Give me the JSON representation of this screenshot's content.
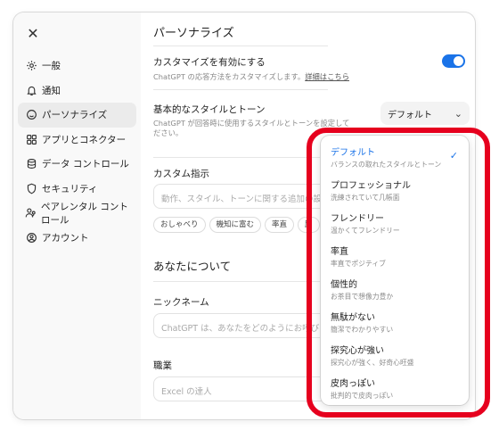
{
  "sidebar": {
    "close_label": "✕",
    "items": [
      {
        "label": "一般",
        "icon": "gear-icon"
      },
      {
        "label": "通知",
        "icon": "bell-icon"
      },
      {
        "label": "パーソナライズ",
        "icon": "personalize-icon",
        "active": true
      },
      {
        "label": "アプリとコネクター",
        "icon": "apps-icon"
      },
      {
        "label": "データ コントロール",
        "icon": "database-icon"
      },
      {
        "label": "セキュリティ",
        "icon": "shield-icon"
      },
      {
        "label": "ペアレンタル コントロール",
        "icon": "parental-icon"
      },
      {
        "label": "アカウント",
        "icon": "account-icon"
      }
    ]
  },
  "main": {
    "title": "パーソナライズ",
    "customize": {
      "label": "カスタマイズを有効にする",
      "desc": "ChatGPT の応答方法をカスタマイズします。",
      "link": "詳細はこちら",
      "enabled": true
    },
    "style": {
      "label": "基本的なスタイルとトーン",
      "desc_line1": "ChatGPT が回答時に使用するスタイルとトーンを設定して",
      "desc_line2": "ださい。",
      "selected": "デフォルト",
      "chevron": "⌄"
    },
    "custom_instructions": {
      "label": "カスタム指示",
      "placeholder": "動作、スタイル、トーンに関する追加の設定",
      "chips": [
        "おしゃべり",
        "機知に富む",
        "率直",
        "励"
      ]
    },
    "about_you": {
      "title": "あなたについて",
      "nickname_label": "ニックネーム",
      "nickname_placeholder": "ChatGPT は、あなたをどのようにお呼びし",
      "job_label": "職業",
      "job_placeholder": "Excel の達人"
    }
  },
  "dropdown": {
    "checkmark": "✓",
    "options": [
      {
        "title": "デフォルト",
        "desc": "バランスの取れたスタイルとトーン",
        "selected": true
      },
      {
        "title": "プロフェッショナル",
        "desc": "洗練されていて几帳面"
      },
      {
        "title": "フレンドリー",
        "desc": "温かくてフレンドリー"
      },
      {
        "title": "率直",
        "desc": "率直でポジティブ"
      },
      {
        "title": "個性的",
        "desc": "お茶目で想像力豊か"
      },
      {
        "title": "無駄がない",
        "desc": "簡潔でわかりやすい"
      },
      {
        "title": "探究心が強い",
        "desc": "探究心が強く、好奇心旺盛"
      },
      {
        "title": "皮肉っぽい",
        "desc": "批判的で皮肉っぽい"
      }
    ]
  },
  "colors": {
    "accent": "#1a73e8",
    "highlight": "#e6001e"
  }
}
